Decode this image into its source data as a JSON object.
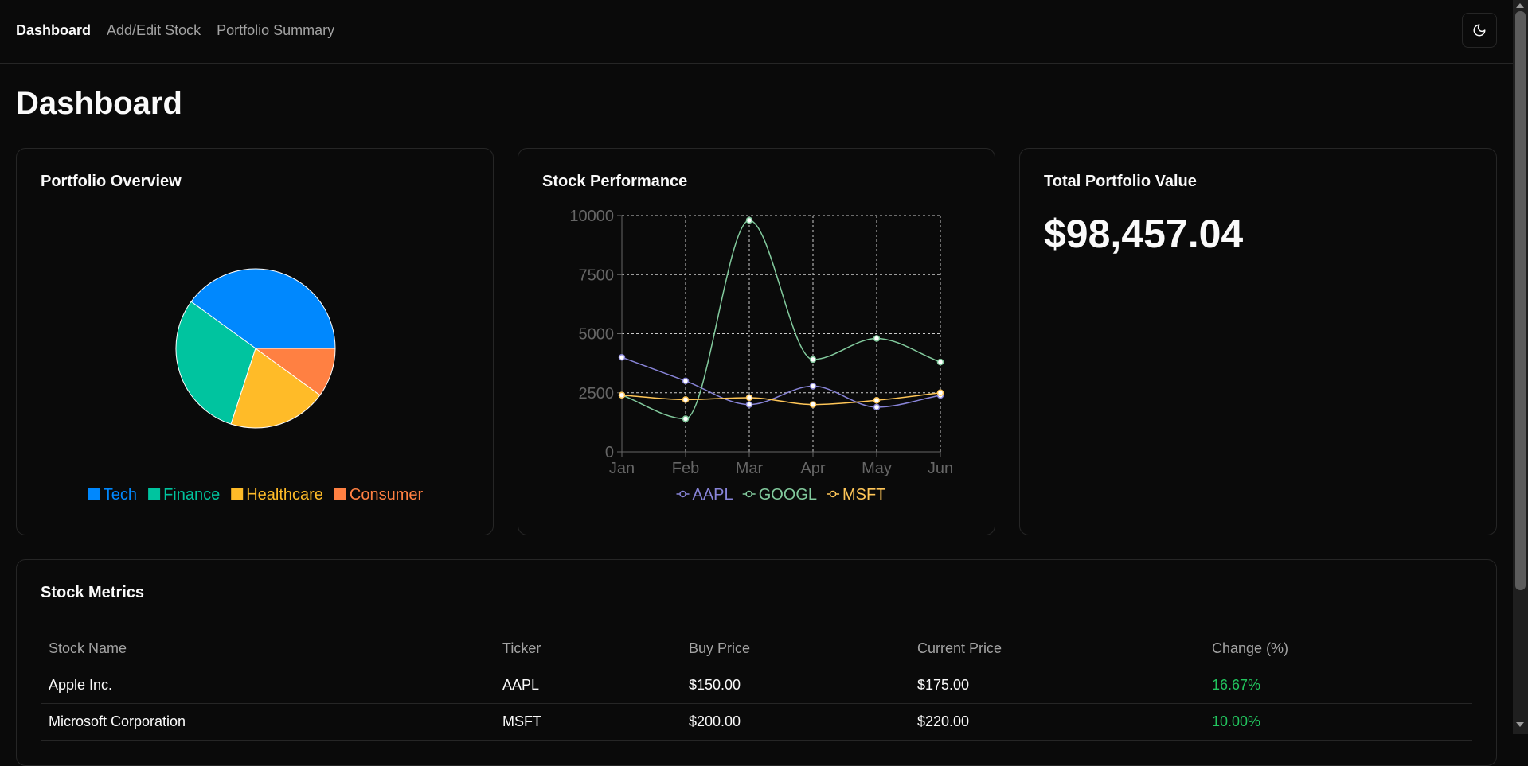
{
  "nav": {
    "links": [
      "Dashboard",
      "Add/Edit Stock",
      "Portfolio Summary"
    ],
    "active": "Dashboard",
    "theme_toggle_icon": "moon-icon"
  },
  "page": {
    "title": "Dashboard"
  },
  "cards": {
    "overview_title": "Portfolio Overview",
    "performance_title": "Stock Performance",
    "total_title": "Total Portfolio Value",
    "total_value": "$98,457.04"
  },
  "chart_data": [
    {
      "type": "pie",
      "title": "",
      "categories": [
        "Tech",
        "Finance",
        "Healthcare",
        "Consumer"
      ],
      "values": [
        40,
        30,
        20,
        10
      ],
      "colors": [
        "#0088FE",
        "#00C49F",
        "#FFBB28",
        "#FF8042"
      ],
      "legend": "bottom"
    },
    {
      "type": "line",
      "title": "",
      "categories": [
        "Jan",
        "Feb",
        "Mar",
        "Apr",
        "May",
        "Jun"
      ],
      "series": [
        {
          "name": "AAPL",
          "color": "#8884d8",
          "values": [
            4000,
            3000,
            2000,
            2780,
            1890,
            2390
          ]
        },
        {
          "name": "GOOGL",
          "color": "#82ca9d",
          "values": [
            2400,
            1398,
            9800,
            3908,
            4800,
            3800
          ]
        },
        {
          "name": "MSFT",
          "color": "#ffc658",
          "values": [
            2400,
            2210,
            2290,
            2000,
            2181,
            2500
          ]
        }
      ],
      "ylim": [
        0,
        10000
      ],
      "yticks": [
        0,
        2500,
        5000,
        7500,
        10000
      ],
      "grid": true,
      "legend": "bottom"
    }
  ],
  "metrics": {
    "title": "Stock Metrics",
    "columns": [
      "Stock Name",
      "Ticker",
      "Buy Price",
      "Current Price",
      "Change (%)"
    ],
    "change_color": "#22c55e",
    "rows": [
      {
        "name": "Apple Inc.",
        "ticker": "AAPL",
        "buy": "$150.00",
        "current": "$175.00",
        "change": "16.67%"
      },
      {
        "name": "Microsoft Corporation",
        "ticker": "MSFT",
        "buy": "$200.00",
        "current": "$220.00",
        "change": "10.00%"
      }
    ]
  }
}
